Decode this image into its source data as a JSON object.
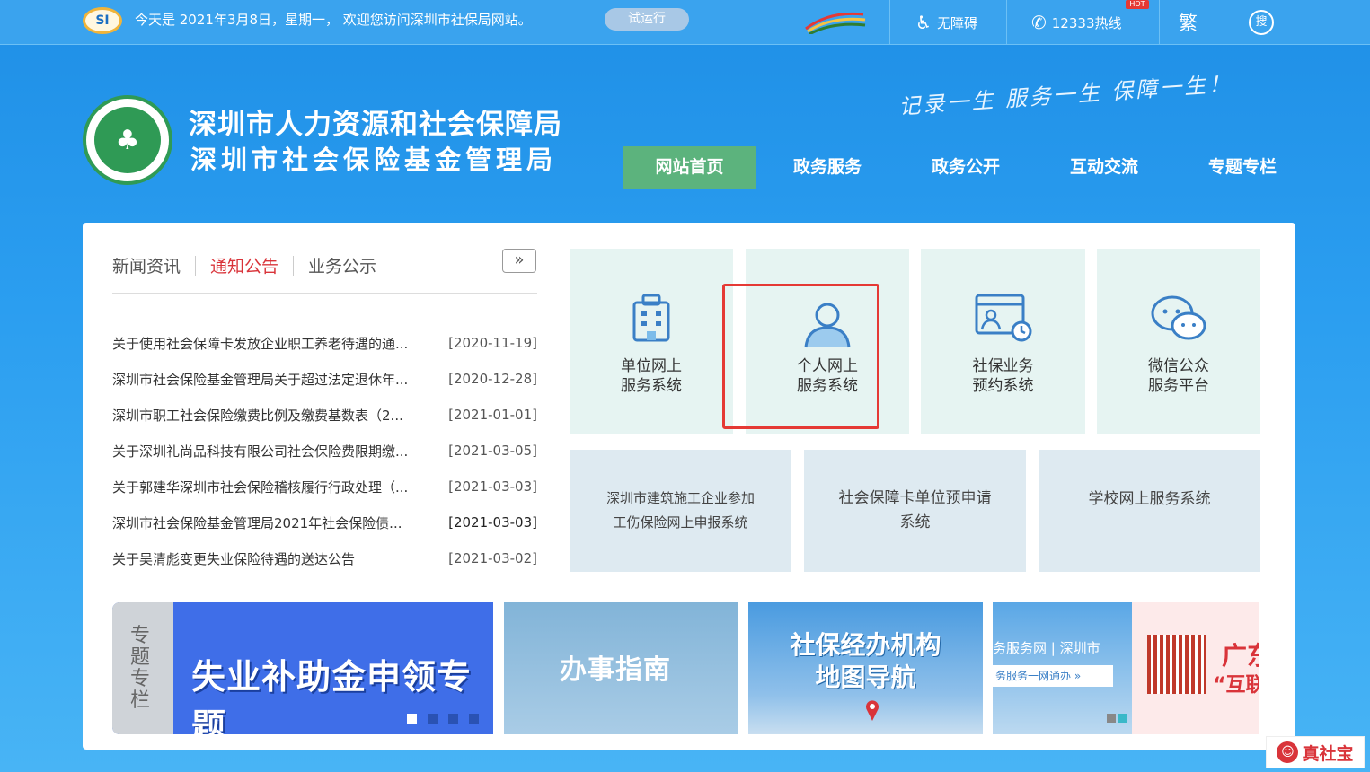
{
  "topbar": {
    "logo_text": "SI",
    "date_text": "今天是 2021年3月8日，星期一，  欢迎您访问深圳市社保局网站。",
    "trial_label": "试运行",
    "accessibility_label": "无障碍",
    "hotline_label": "12333热线",
    "hot_badge": "HOT",
    "traditional_label": "繁",
    "search_label": "搜"
  },
  "header": {
    "org_name_1": "深圳市人力资源和社会保障局",
    "org_name_2": "深圳市社会保险基金管理局",
    "slogan": "记录一生 服务一生 保障一生！"
  },
  "nav": [
    {
      "label": "网站首页",
      "active": true
    },
    {
      "label": "政务服务",
      "active": false
    },
    {
      "label": "政务公开",
      "active": false
    },
    {
      "label": "互动交流",
      "active": false
    },
    {
      "label": "专题专栏",
      "active": false
    }
  ],
  "news": {
    "tabs": [
      {
        "label": "新闻资讯",
        "active": false
      },
      {
        "label": "通知公告",
        "active": true
      },
      {
        "label": "业务公示",
        "active": false
      }
    ],
    "more_label": "»",
    "items": [
      {
        "title": "关于使用社会保障卡发放企业职工养老待遇的通...",
        "date": "[2020-11-19]"
      },
      {
        "title": "深圳市社会保险基金管理局关于超过法定退休年...",
        "date": "[2020-12-28]"
      },
      {
        "title": "深圳市职工社会保险缴费比例及缴费基数表（2...",
        "date": "[2021-01-01]"
      },
      {
        "title": "关于深圳礼尚品科技有限公司社会保险费限期缴...",
        "date": "[2021-03-05]"
      },
      {
        "title": "关于郭建华深圳市社会保险稽核履行行政处理（...",
        "date": "[2021-03-03]"
      },
      {
        "title": "深圳市社会保险基金管理局2021年社会保险债...",
        "date": "[2021-03-03]"
      },
      {
        "title": "关于吴清彪变更失业保险待遇的送达公告",
        "date": "[2021-03-02]"
      }
    ]
  },
  "services": {
    "tiles": [
      {
        "line1": "单位网上",
        "line2": "服务系统",
        "icon": "building-icon"
      },
      {
        "line1": "个人网上",
        "line2": "服务系统",
        "icon": "person-icon"
      },
      {
        "line1": "社保业务",
        "line2": "预约系统",
        "icon": "appointment-icon"
      },
      {
        "line1": "微信公众",
        "line2": "服务平台",
        "icon": "wechat-icon"
      }
    ],
    "wide_tiles": [
      {
        "line1": "深圳市建筑施工企业参加",
        "line2": "工伤保险网上申报系统"
      },
      {
        "line1": "社会保障卡单位预申请",
        "line2": "系统"
      },
      {
        "line1": "学校网上服务系统",
        "line2": ""
      }
    ]
  },
  "banners": {
    "topic_side": "专题专栏",
    "topic_title": "失业补助金申领专题",
    "guide_title": "办事指南",
    "map_title_1": "社保经办机构",
    "map_title_2": "地图导航",
    "gov_text_1": "务服务网 | 深圳市",
    "gov_text_2": "务服务一网通办 »",
    "gd_text_1": "广东",
    "gd_text_2": "“互联"
  },
  "watermark": {
    "text": "真社宝"
  },
  "colors": {
    "active_nav": "#5cb37d",
    "active_tab": "#d9343a",
    "highlight": "#e53935"
  }
}
